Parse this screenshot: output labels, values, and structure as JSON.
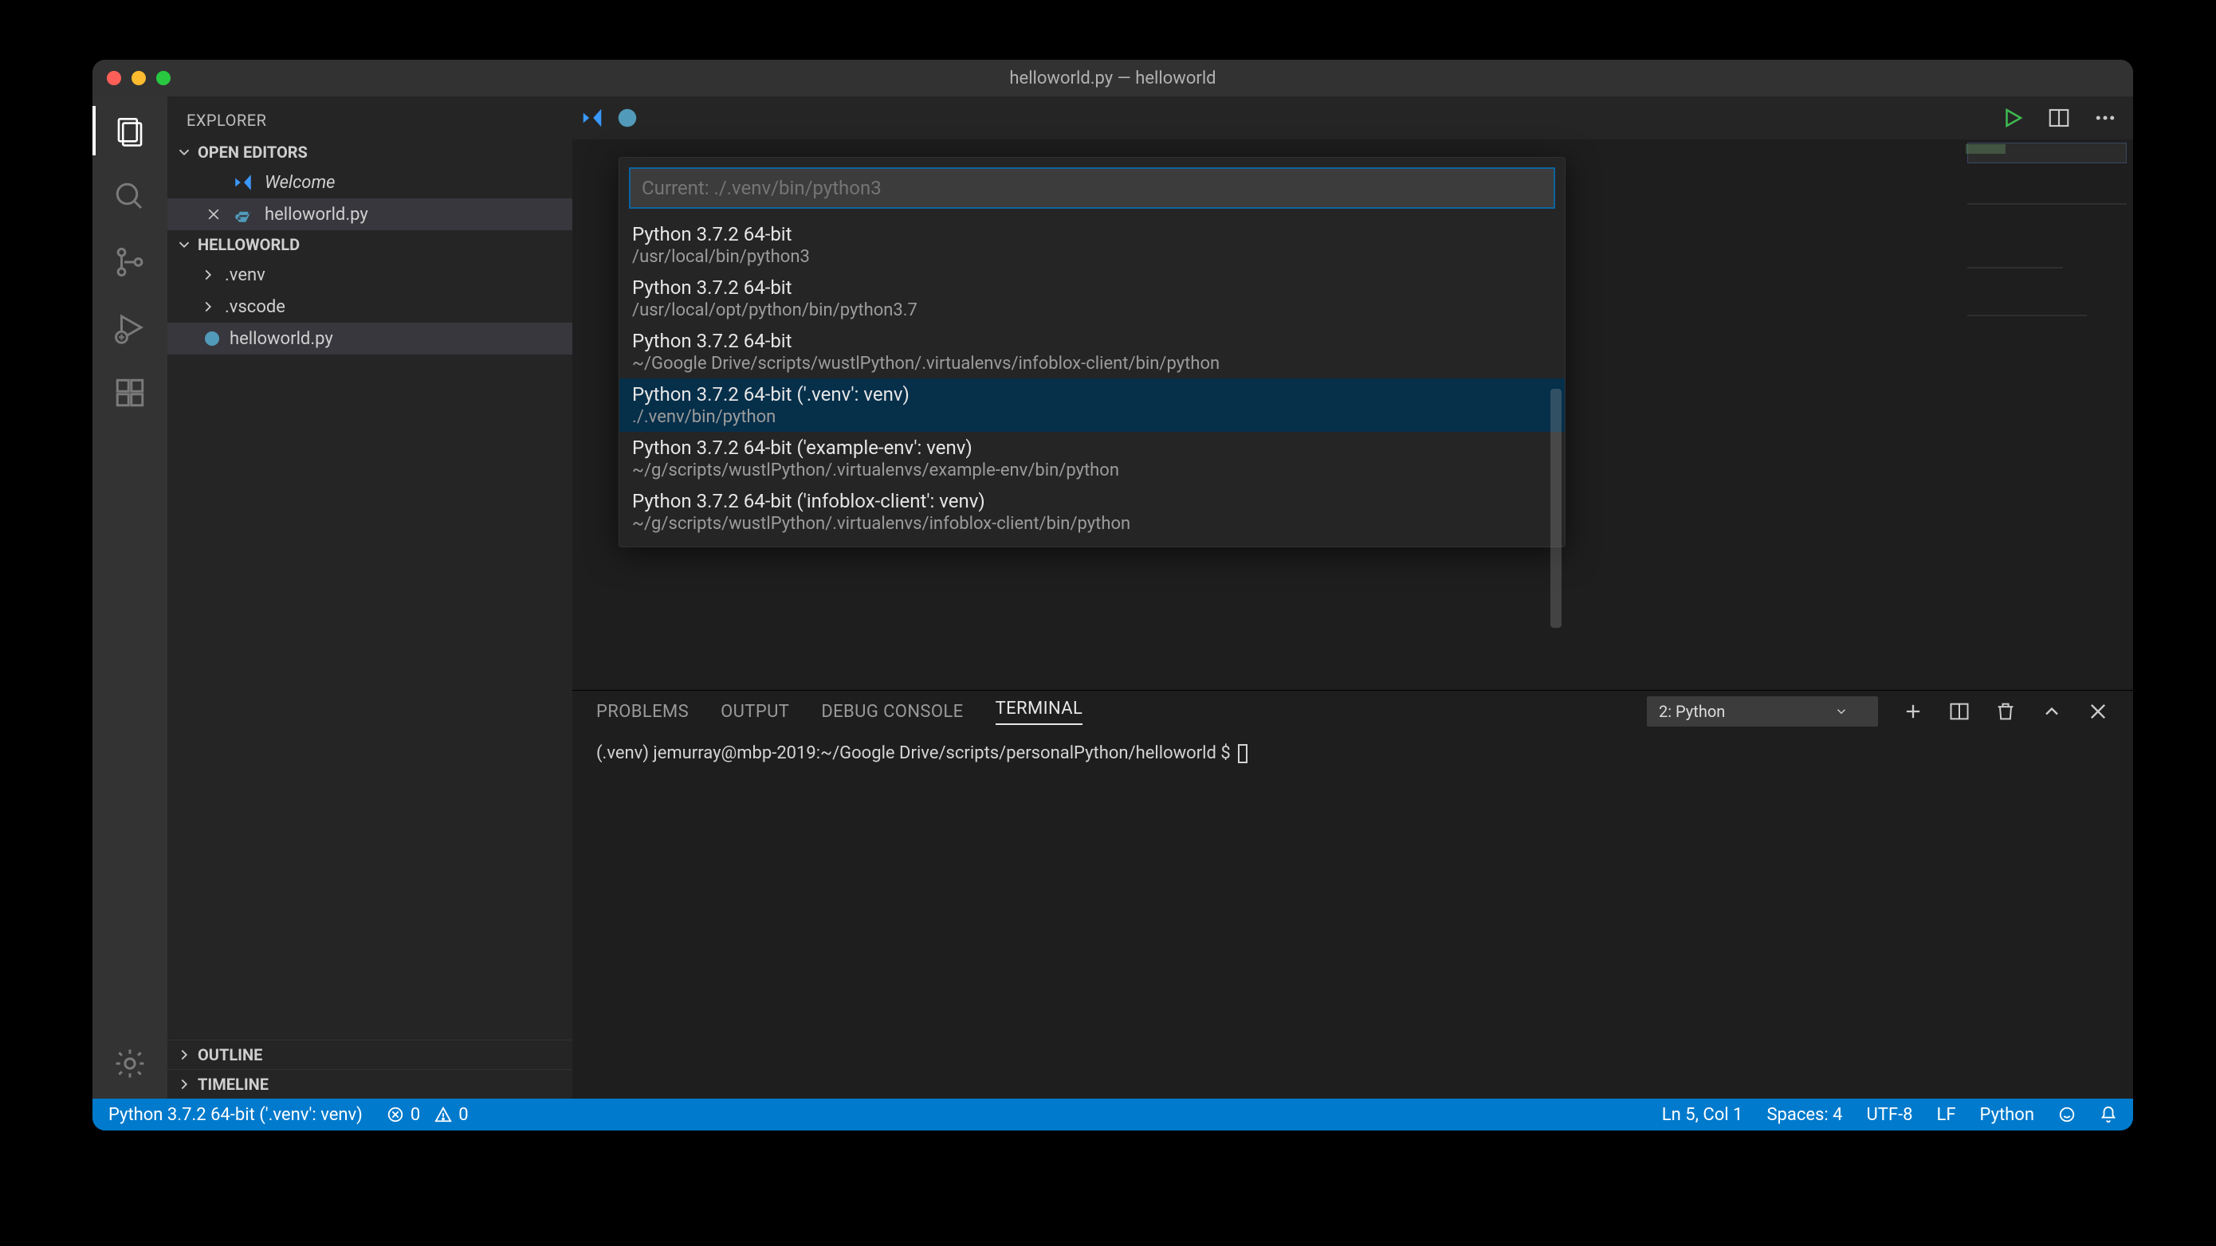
{
  "window": {
    "title": "helloworld.py — helloworld"
  },
  "sidebar": {
    "title": "EXPLORER",
    "openEditorsLabel": "OPEN EDITORS",
    "openEditors": [
      {
        "label": "Welcome",
        "icon": "vscode-icon"
      },
      {
        "label": "helloworld.py",
        "icon": "python-file-icon",
        "close": true
      }
    ],
    "folderLabel": "HELLOWORLD",
    "tree": [
      {
        "label": ".venv",
        "type": "folder"
      },
      {
        "label": ".vscode",
        "type": "folder"
      },
      {
        "label": "helloworld.py",
        "type": "file",
        "selected": true
      }
    ],
    "outlineLabel": "OUTLINE",
    "timelineLabel": "TIMELINE"
  },
  "tabbar": {
    "leftIcons": [
      "vscode-icon",
      "python-file-icon"
    ]
  },
  "quickpick": {
    "placeholder": "Current: ./.venv/bin/python3",
    "items": [
      {
        "title": "Python 3.7.2 64-bit",
        "path": "/usr/local/bin/python3"
      },
      {
        "title": "Python 3.7.2 64-bit",
        "path": "/usr/local/opt/python/bin/python3.7"
      },
      {
        "title": "Python 3.7.2 64-bit",
        "path": "~/Google Drive/scripts/wustlPython/.virtualenvs/infoblox-client/bin/python"
      },
      {
        "title": "Python 3.7.2 64-bit ('.venv': venv)",
        "path": "./.venv/bin/python",
        "highlight": true
      },
      {
        "title": "Python 3.7.2 64-bit ('example-env': venv)",
        "path": "~/g/scripts/wustlPython/.virtualenvs/example-env/bin/python"
      },
      {
        "title": "Python 3.7.2 64-bit ('infoblox-client': venv)",
        "path": "~/g/scripts/wustlPython/.virtualenvs/infoblox-client/bin/python"
      }
    ]
  },
  "panel": {
    "tabs": [
      "PROBLEMS",
      "OUTPUT",
      "DEBUG CONSOLE",
      "TERMINAL"
    ],
    "activeTab": "TERMINAL",
    "terminalSelect": "2: Python",
    "terminalLine": "(.venv) jemurray@mbp-2019:~/Google Drive/scripts/personalPython/helloworld $ "
  },
  "status": {
    "interpreter": "Python 3.7.2 64-bit ('.venv': venv)",
    "errors": "0",
    "warnings": "0",
    "cursor": "Ln 5, Col 1",
    "spaces": "Spaces: 4",
    "encoding": "UTF-8",
    "eol": "LF",
    "lang": "Python"
  }
}
